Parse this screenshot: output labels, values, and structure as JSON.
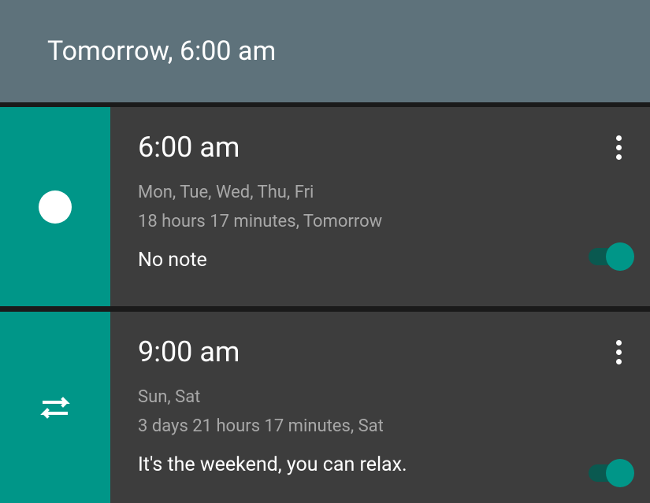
{
  "header": {
    "title": "Tomorrow, 6:00 am"
  },
  "alarms": [
    {
      "icon": "compass",
      "time": "6:00 am",
      "days": "Mon, Tue, Wed, Thu, Fri",
      "countdown": "18 hours 17 minutes, Tomorrow",
      "note": "No note",
      "enabled": true
    },
    {
      "icon": "repeat",
      "time": "9:00 am",
      "days": "Sun, Sat",
      "countdown": "3 days 21 hours 17 minutes, Sat",
      "note": "It's the weekend, you can relax.",
      "enabled": true
    }
  ],
  "colors": {
    "accent": "#009688",
    "headerBg": "#5e727b",
    "cardBg": "#3d3d3d"
  }
}
